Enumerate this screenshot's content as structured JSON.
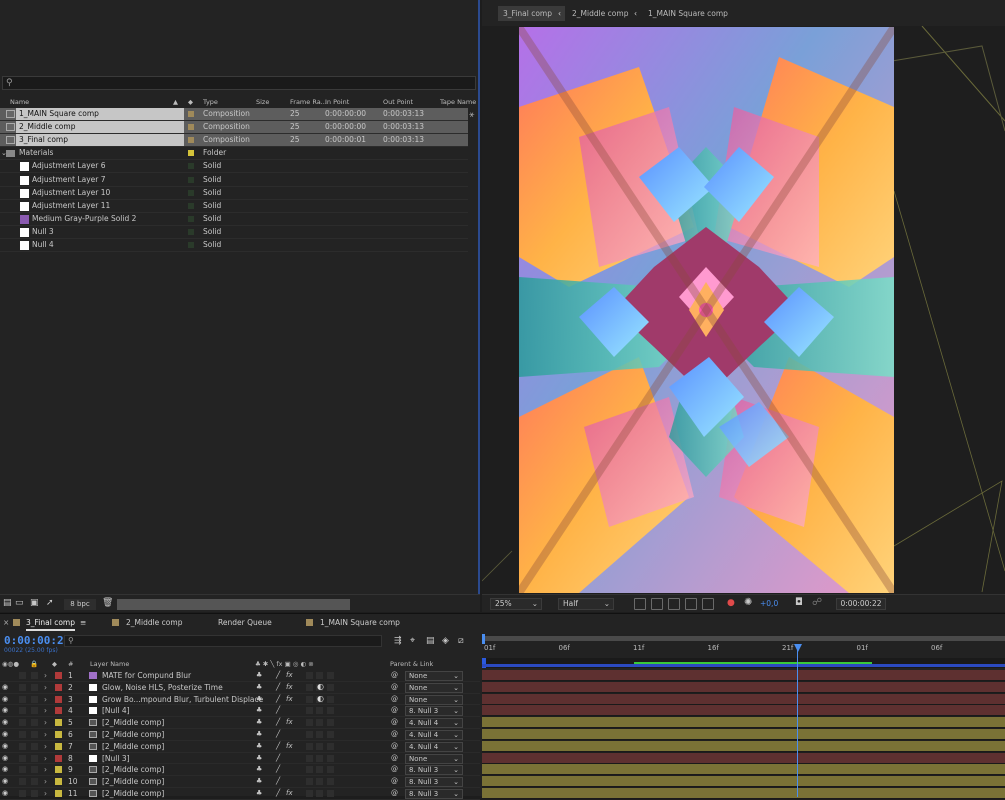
{
  "project": {
    "search_placeholder": "",
    "columns": [
      "Name",
      "Type",
      "Size",
      "Frame Ra...",
      "In Point",
      "Out Point",
      "Tape Name"
    ],
    "items": [
      {
        "name": "1_MAIN Square comp",
        "type": "Composition",
        "fps": "25",
        "in": "0:00:00:00",
        "out": "0:00:03:13",
        "selected": true,
        "label": "#a08a5a",
        "kind": "comp"
      },
      {
        "name": "2_Middle comp",
        "type": "Composition",
        "fps": "25",
        "in": "0:00:00:00",
        "out": "0:00:03:13",
        "selected": true,
        "label": "#a08a5a",
        "kind": "comp"
      },
      {
        "name": "3_Final comp",
        "type": "Composition",
        "fps": "25",
        "in": "0:00:00:01",
        "out": "0:00:03:13",
        "selected": true,
        "label": "#a08a5a",
        "kind": "comp"
      },
      {
        "name": "Materials",
        "type": "Folder",
        "fps": "",
        "in": "",
        "out": "",
        "selected": false,
        "label": "#d4c33a",
        "kind": "folder"
      },
      {
        "name": "Adjustment Layer 6",
        "type": "Solid",
        "fps": "",
        "in": "",
        "out": "",
        "selected": false,
        "label": "#2a3a2a",
        "kind": "solid",
        "swatch": "#ffffff"
      },
      {
        "name": "Adjustment Layer 7",
        "type": "Solid",
        "fps": "",
        "in": "",
        "out": "",
        "selected": false,
        "label": "#2a3a2a",
        "kind": "solid",
        "swatch": "#ffffff"
      },
      {
        "name": "Adjustment Layer 10",
        "type": "Solid",
        "fps": "",
        "in": "",
        "out": "",
        "selected": false,
        "label": "#2a3a2a",
        "kind": "solid",
        "swatch": "#ffffff"
      },
      {
        "name": "Adjustment Layer 11",
        "type": "Solid",
        "fps": "",
        "in": "",
        "out": "",
        "selected": false,
        "label": "#2a3a2a",
        "kind": "solid",
        "swatch": "#ffffff"
      },
      {
        "name": "Medium Gray-Purple Solid 2",
        "type": "Solid",
        "fps": "",
        "in": "",
        "out": "",
        "selected": false,
        "label": "#2a3a2a",
        "kind": "solid",
        "swatch": "#8a5ab0"
      },
      {
        "name": "Null 3",
        "type": "Solid",
        "fps": "",
        "in": "",
        "out": "",
        "selected": false,
        "label": "#2a3a2a",
        "kind": "solid",
        "swatch": "#ffffff"
      },
      {
        "name": "Null 4",
        "type": "Solid",
        "fps": "",
        "in": "",
        "out": "",
        "selected": false,
        "label": "#2a3a2a",
        "kind": "solid",
        "swatch": "#ffffff"
      }
    ],
    "bpc": "8 bpc"
  },
  "viewer": {
    "tabs": [
      "3_Final comp",
      "2_Middle comp",
      "1_MAIN Square comp"
    ],
    "zoom": "25%",
    "resolution": "Half",
    "exposure": "+0,0",
    "timecode": "0:00:00:22"
  },
  "timeline": {
    "tabs": [
      "3_Final comp",
      "2_Middle comp",
      "Render Queue",
      "1_MAIN Square comp"
    ],
    "timecode": "0:00:00:22",
    "frame_info": "00022 (25.00 fps)",
    "col_layer_name": "Layer Name",
    "col_num": "#",
    "col_parent": "Parent & Link",
    "ruler": [
      "01f",
      "06f",
      "11f",
      "16f",
      "21f",
      "01f",
      "06f"
    ],
    "layers": [
      {
        "num": "1",
        "name": "MATE for Compund Blur",
        "parent": "None",
        "label": "#b03a3a",
        "icon": "solid",
        "swatch": "#a070c8"
      },
      {
        "num": "2",
        "name": "Glow, Noise HLS, Posterize Time",
        "parent": "None",
        "label": "#b03a3a",
        "icon": "solid",
        "swatch": "#ffffff"
      },
      {
        "num": "3",
        "name": "Grow Bo...mpound Blur, Turbulent Displace",
        "parent": "None",
        "label": "#b03a3a",
        "icon": "solid",
        "swatch": "#ffffff"
      },
      {
        "num": "4",
        "name": "[Null 4]",
        "parent": "8. Null 3",
        "label": "#b03a3a",
        "icon": "solid",
        "swatch": "#ffffff"
      },
      {
        "num": "5",
        "name": "[2_Middle comp]",
        "parent": "4. Null 4",
        "label": "#c8b840",
        "icon": "comp"
      },
      {
        "num": "6",
        "name": "[2_Middle comp]",
        "parent": "4. Null 4",
        "label": "#c8b840",
        "icon": "comp"
      },
      {
        "num": "7",
        "name": "[2_Middle comp]",
        "parent": "4. Null 4",
        "label": "#c8b840",
        "icon": "comp"
      },
      {
        "num": "8",
        "name": "[Null 3]",
        "parent": "None",
        "label": "#b03a3a",
        "icon": "solid",
        "swatch": "#ffffff"
      },
      {
        "num": "9",
        "name": "[2_Middle comp]",
        "parent": "8. Null 3",
        "label": "#c8b840",
        "icon": "comp"
      },
      {
        "num": "10",
        "name": "[2_Middle comp]",
        "parent": "8. Null 3",
        "label": "#c8b840",
        "icon": "comp"
      },
      {
        "num": "11",
        "name": "[2_Middle comp]",
        "parent": "8. Null 3",
        "label": "#c8b840",
        "icon": "comp"
      }
    ]
  }
}
